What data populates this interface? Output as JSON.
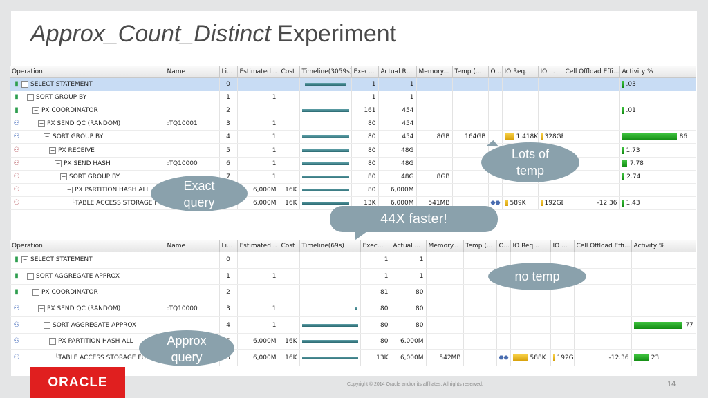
{
  "title": {
    "italic": "Approx_Count_Distinct",
    "rest": " Experiment"
  },
  "exact_plan": {
    "headers": [
      "Operation",
      "Name",
      "Li...",
      "Estimated...",
      "Cost",
      "Timeline(3059s)",
      "Exec...",
      "Actual R...",
      "Memory...",
      "Temp (...",
      "O...",
      "IO Req...",
      "IO ...",
      "Cell Offload Effi...",
      "Activity %"
    ],
    "rows": [
      {
        "op": "SELECT STATEMENT",
        "name": "",
        "line": "0",
        "est": "",
        "cost": "",
        "exec": "1",
        "actual": "1",
        "mem": "",
        "temp": "",
        "io_req": "",
        "io_bytes": "",
        "cell": "",
        "activity": ".03",
        "activity_pct": 1,
        "timeline": [
          0.07,
          0.93
        ]
      },
      {
        "op": "SORT GROUP BY",
        "name": "",
        "line": "1",
        "est": "1",
        "cost": "",
        "exec": "1",
        "actual": "1",
        "mem": "",
        "temp": "",
        "io_req": "",
        "io_bytes": "",
        "cell": "",
        "activity": "",
        "activity_pct": 0,
        "timeline": null
      },
      {
        "op": "PX COORDINATOR",
        "name": "",
        "line": "2",
        "est": "",
        "cost": "",
        "exec": "161",
        "actual": "454",
        "mem": "",
        "temp": "",
        "io_req": "",
        "io_bytes": "",
        "cell": "",
        "activity": ".01",
        "activity_pct": 1,
        "timeline": [
          0.0,
          1.0
        ]
      },
      {
        "op": "PX SEND QC (RANDOM)",
        "name": ":TQ10001",
        "line": "3",
        "est": "1",
        "cost": "",
        "exec": "80",
        "actual": "454",
        "mem": "",
        "temp": "",
        "io_req": "",
        "io_bytes": "",
        "cell": "",
        "activity": "",
        "activity_pct": 0,
        "timeline": null
      },
      {
        "op": "SORT GROUP BY",
        "name": "",
        "line": "4",
        "est": "1",
        "cost": "",
        "exec": "80",
        "actual": "454",
        "mem": "8GB",
        "temp": "164GB",
        "io_req": "1,418K",
        "io_bytes": "328GB",
        "cell": "",
        "activity": "86",
        "activity_pct": 86,
        "timeline": [
          0.0,
          1.0
        ]
      },
      {
        "op": "PX RECEIVE",
        "name": "",
        "line": "5",
        "est": "1",
        "cost": "",
        "exec": "80",
        "actual": "48G",
        "mem": "",
        "temp": "",
        "io_req": "",
        "io_bytes": "",
        "cell": "",
        "activity": "1.73",
        "activity_pct": 2,
        "timeline": [
          0.0,
          1.0
        ]
      },
      {
        "op": "PX SEND HASH",
        "name": ":TQ10000",
        "line": "6",
        "est": "1",
        "cost": "",
        "exec": "80",
        "actual": "48G",
        "mem": "",
        "temp": "",
        "io_req": "",
        "io_bytes": "",
        "cell": "",
        "activity": "7.78",
        "activity_pct": 8,
        "timeline": [
          0.0,
          1.0
        ]
      },
      {
        "op": "SORT GROUP BY",
        "name": "",
        "line": "7",
        "est": "1",
        "cost": "",
        "exec": "80",
        "actual": "48G",
        "mem": "8GB",
        "temp": "",
        "io_req": "",
        "io_bytes": "",
        "cell": "",
        "activity": "2.74",
        "activity_pct": 3,
        "timeline": [
          0.0,
          1.0
        ]
      },
      {
        "op": "PX PARTITION HASH ALL",
        "name": "",
        "line": "8",
        "est": "6,000M",
        "cost": "16K",
        "exec": "80",
        "actual": "6,000M",
        "mem": "",
        "temp": "",
        "io_req": "",
        "io_bytes": "",
        "cell": "",
        "activity": "",
        "activity_pct": 0,
        "timeline": [
          0.0,
          1.0
        ]
      },
      {
        "op": "TABLE ACCESS STORAGE F...",
        "name": "",
        "line": "9",
        "est": "6,000M",
        "cost": "16K",
        "exec": "13K",
        "actual": "6,000M",
        "mem": "541MB",
        "temp": "",
        "io_req": "589K",
        "io_bytes": "192GB",
        "cell": "-12.36",
        "activity": "1.43",
        "activity_pct": 1,
        "timeline": [
          0.0,
          1.0
        ]
      }
    ]
  },
  "approx_plan": {
    "headers": [
      "Operation",
      "Name",
      "Li...",
      "Estimated...",
      "Cost",
      "Timeline(69s)",
      "Exec...",
      "Actual ...",
      "Memory...",
      "Temp (...",
      "O...",
      "IO Req...",
      "IO ...",
      "Cell Offload Effi...",
      "Activity %"
    ],
    "rows": [
      {
        "op": "SELECT STATEMENT",
        "name": "",
        "line": "0",
        "est": "",
        "cost": "",
        "exec": "1",
        "actual": "1",
        "mem": "",
        "temp": "",
        "io_req": "",
        "io_bytes": "",
        "cell": "",
        "activity": "",
        "activity_pct": 0,
        "timeline": [
          0.98,
          1.0
        ]
      },
      {
        "op": "SORT AGGREGATE APPROX",
        "name": "",
        "line": "1",
        "est": "1",
        "cost": "",
        "exec": "1",
        "actual": "1",
        "mem": "",
        "temp": "",
        "io_req": "",
        "io_bytes": "",
        "cell": "",
        "activity": "",
        "activity_pct": 0,
        "timeline": [
          0.98,
          1.0
        ]
      },
      {
        "op": "PX COORDINATOR",
        "name": "",
        "line": "2",
        "est": "",
        "cost": "",
        "exec": "81",
        "actual": "80",
        "mem": "",
        "temp": "",
        "io_req": "",
        "io_bytes": "",
        "cell": "",
        "activity": "",
        "activity_pct": 0,
        "timeline": [
          0.98,
          1.0
        ]
      },
      {
        "op": "PX SEND QC (RANDOM)",
        "name": ":TQ10000",
        "line": "3",
        "est": "1",
        "cost": "",
        "exec": "80",
        "actual": "80",
        "mem": "",
        "temp": "",
        "io_req": "",
        "io_bytes": "",
        "cell": "",
        "activity": "",
        "activity_pct": 0,
        "timeline": [
          0.95,
          1.0
        ]
      },
      {
        "op": "SORT AGGREGATE APPROX",
        "name": "",
        "line": "4",
        "est": "1",
        "cost": "",
        "exec": "80",
        "actual": "80",
        "mem": "",
        "temp": "",
        "io_req": "",
        "io_bytes": "",
        "cell": "",
        "activity": "77",
        "activity_pct": 77,
        "timeline": [
          0.0,
          1.0
        ]
      },
      {
        "op": "PX PARTITION HASH ALL",
        "name": "",
        "line": "5",
        "est": "6,000M",
        "cost": "16K",
        "exec": "80",
        "actual": "6,000M",
        "mem": "",
        "temp": "",
        "io_req": "",
        "io_bytes": "",
        "cell": "",
        "activity": "",
        "activity_pct": 0,
        "timeline": [
          0.0,
          1.0
        ]
      },
      {
        "op": "TABLE ACCESS STORAGE FULL",
        "name": "",
        "line": "6",
        "est": "6,000M",
        "cost": "16K",
        "exec": "13K",
        "actual": "6,000M",
        "mem": "542MB",
        "temp": "",
        "io_req": "588K",
        "io_bytes": "192GB",
        "cell": "-12.36",
        "activity": "23",
        "activity_pct": 23,
        "timeline": [
          0.0,
          1.0
        ]
      }
    ]
  },
  "callouts": {
    "temp": "Lots of temp",
    "exact": "Exact query",
    "faster": "44X faster!",
    "no_temp": "no temp",
    "approx": "Approx query"
  },
  "footer": {
    "logo": "ORACLE",
    "copyright": "Copyright © 2014 Oracle and/or its affiliates. All rights reserved.  |",
    "page": "14"
  },
  "colors": {
    "timeline_bar": "#2b6a72",
    "activity_bar": "#1ea51e",
    "callout": "#8aa1ac",
    "logo": "#e01f1f",
    "selected_row": "#c8dcf4"
  }
}
